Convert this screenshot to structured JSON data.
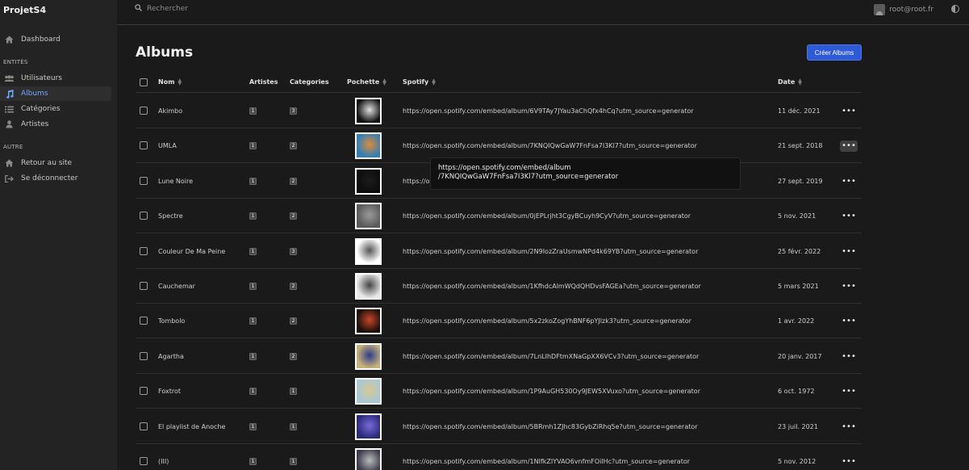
{
  "app": {
    "brand": "ProjetS4"
  },
  "sidebar": {
    "dashboard": {
      "label": "Dashboard",
      "icon": "home-icon"
    },
    "section_entities": "ENTITÉS",
    "entities": [
      {
        "label": "Utilisateurs",
        "icon": "users-icon",
        "active": false
      },
      {
        "label": "Albums",
        "icon": "music-note-icon",
        "active": true
      },
      {
        "label": "Catégories",
        "icon": "list-icon",
        "active": false
      },
      {
        "label": "Artistes",
        "icon": "user-icon",
        "active": false
      }
    ],
    "section_other": "AUTRE",
    "other": [
      {
        "label": "Retour au site",
        "icon": "home-icon"
      },
      {
        "label": "Se déconnecter",
        "icon": "sign-out-icon"
      }
    ]
  },
  "topbar": {
    "search_placeholder": "Rechercher",
    "user_email": "root@root.fr"
  },
  "page": {
    "title": "Albums",
    "create_button": "Créer Albums"
  },
  "table": {
    "headers": {
      "name": "Nom",
      "artists": "Artistes",
      "categories": "Categories",
      "cover": "Pochette",
      "spotify": "Spotify",
      "date": "Date"
    },
    "rows": [
      {
        "name": "Akimbo",
        "artists": "1",
        "categories": "3",
        "spotify": "https://open.spotify.com/embed/album/6V9TAy7JYau3aChQfx4hCq?utm_source=generator",
        "date": "11 déc. 2021",
        "cover_color": "#111111",
        "cover_accent": "#e0e0e0"
      },
      {
        "name": "UMLA",
        "artists": "1",
        "categories": "2",
        "spotify": "https://open.spotify.com/embed/album/7KNQIQwGaW7FnFsa7I3Kl7?utm_source=generator",
        "date": "21 sept. 2018",
        "cover_color": "#2f7fb8",
        "cover_accent": "#e08a3a"
      },
      {
        "name": "Lune Noire",
        "artists": "1",
        "categories": "2",
        "spotify": "https://open.spotify.com/embed/album/7KNQIQwGaW7FnFsa7I3Kl7?utm_source=generator",
        "date": "27 sept. 2019",
        "cover_color": "#0c0c0c",
        "cover_accent": "#1c1c1c"
      },
      {
        "name": "Spectre",
        "artists": "1",
        "categories": "2",
        "spotify": "https://open.spotify.com/embed/album/0jEPLrjht3CgyBCuyh9CyV?utm_source=generator",
        "date": "5 nov. 2021",
        "cover_color": "#5a5a5a",
        "cover_accent": "#9a9a9a"
      },
      {
        "name": "Couleur De Ma Peine",
        "artists": "1",
        "categories": "3",
        "spotify": "https://open.spotify.com/embed/album/2N9IozZraUsmwNPd4k69YB?utm_source=generator",
        "date": "25 févr. 2022",
        "cover_color": "#ffffff",
        "cover_accent": "#555555"
      },
      {
        "name": "Cauchemar",
        "artists": "1",
        "categories": "2",
        "spotify": "https://open.spotify.com/embed/album/1KfhdcAlmWQdQHDvsFAGEa?utm_source=generator",
        "date": "5 mars 2021",
        "cover_color": "#e8e8e8",
        "cover_accent": "#444444"
      },
      {
        "name": "Tombolo",
        "artists": "1",
        "categories": "2",
        "spotify": "https://open.spotify.com/embed/album/5x2zkoZogYhBNF6pYJlzk3?utm_source=generator",
        "date": "1 avr. 2022",
        "cover_color": "#1a0f0a",
        "cover_accent": "#c8452a"
      },
      {
        "name": "Agartha",
        "artists": "1",
        "categories": "2",
        "spotify": "https://open.spotify.com/embed/album/7LnLIhDFtmXNaGpXX6VCv3?utm_source=generator",
        "date": "20 janv. 2017",
        "cover_color": "#c9b27a",
        "cover_accent": "#2a3c8a"
      },
      {
        "name": "Foxtrot",
        "artists": "1",
        "categories": "1",
        "spotify": "https://open.spotify.com/embed/album/1P9AuGH530Oy9JEW5XVuxo?utm_source=generator",
        "date": "6 oct. 1972",
        "cover_color": "#a8c8d8",
        "cover_accent": "#d8c890"
      },
      {
        "name": "El playlist de Anoche",
        "artists": "1",
        "categories": "1",
        "spotify": "https://open.spotify.com/embed/album/5BRmh1ZJhc83GybZiRhq5e?utm_source=generator",
        "date": "23 juil. 2021",
        "cover_color": "#2a2a7a",
        "cover_accent": "#7a6ad8"
      },
      {
        "name": "(III)",
        "artists": "1",
        "categories": "1",
        "spotify": "https://open.spotify.com/embed/album/1NIfkZIYVAO6vnfmFOilHc?utm_source=generator",
        "date": "5 nov. 2012",
        "cover_color": "#3a3a4a",
        "cover_accent": "#bbbbbb"
      }
    ],
    "hovered_row": 1
  },
  "tooltip": {
    "line1": "https://open.spotify.com/embed/album",
    "line2": "/7KNQIQwGaW7FnFsa7I3Kl7?utm_source=generator"
  },
  "colors": {
    "accent": "#2f5ad6",
    "active_nav": "#6ea8ff",
    "background": "#1a1a1a",
    "sidebar": "#232323"
  }
}
